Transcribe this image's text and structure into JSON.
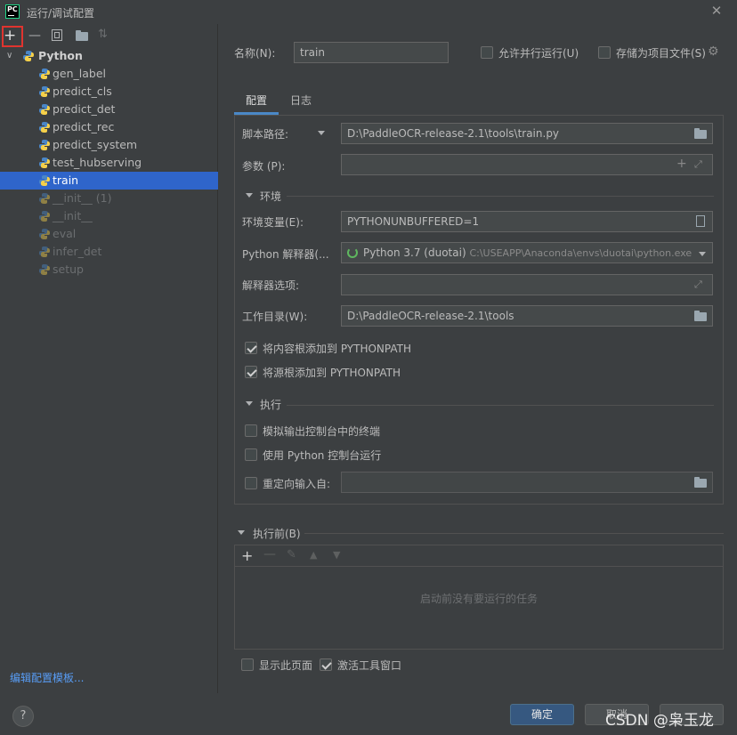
{
  "window": {
    "title": "运行/调试配置",
    "app_icon": "PC"
  },
  "toolbar_left": {
    "add": "+",
    "remove": "—"
  },
  "tree": {
    "root": "Python",
    "items": [
      {
        "label": "gen_label",
        "state": "normal"
      },
      {
        "label": "predict_cls",
        "state": "normal"
      },
      {
        "label": "predict_det",
        "state": "normal"
      },
      {
        "label": "predict_rec",
        "state": "normal"
      },
      {
        "label": "predict_system",
        "state": "normal"
      },
      {
        "label": "test_hubserving",
        "state": "normal"
      },
      {
        "label": "train",
        "state": "selected"
      },
      {
        "label": "__init__ (1)",
        "state": "dim"
      },
      {
        "label": "__init__",
        "state": "dim"
      },
      {
        "label": "eval",
        "state": "dim"
      },
      {
        "label": "infer_det",
        "state": "dim"
      },
      {
        "label": "setup",
        "state": "dim"
      }
    ]
  },
  "edit_template_link": "编辑配置模板...",
  "help": "?",
  "header": {
    "name_label": "名称(N):",
    "name_value": "train",
    "parallel_label": "允许并行运行(U)",
    "store_label": "存储为项目文件(S)"
  },
  "tabs": [
    {
      "label": "配置",
      "active": true
    },
    {
      "label": "日志",
      "active": false
    }
  ],
  "config": {
    "script_label": "脚本路径:",
    "script_value": "D:\\PaddleOCR-release-2.1\\tools\\train.py",
    "params_label": "参数 (P):",
    "params_value": "",
    "env_section": "环境",
    "envvars_label": "环境变量(E):",
    "envvars_value": "PYTHONUNBUFFERED=1",
    "interp_label": "Python 解释器(...",
    "interp_name": "Python 3.7 (duotai)",
    "interp_path": "C:\\USEAPP\\Anaconda\\envs\\duotai\\python.exe",
    "interp_opts_label": "解释器选项:",
    "workdir_label": "工作目录(W):",
    "workdir_value": "D:\\PaddleOCR-release-2.1\\tools",
    "add_content_roots": "将内容根添加到 PYTHONPATH",
    "add_source_roots": "将源根添加到 PYTHONPATH",
    "exec_section": "执行",
    "emulate_terminal": "模拟输出控制台中的终端",
    "python_console": "使用 Python 控制台运行",
    "redirect_input": "重定向输入自:"
  },
  "before_launch": {
    "section": "执行前(B)",
    "empty_text": "启动前没有要运行的任务"
  },
  "footer": {
    "show_page": "显示此页面",
    "activate_tool": "激活工具窗口",
    "ok": "确定",
    "cancel": "取消",
    "apply": ""
  },
  "watermark": "CSDN @枭玉龙",
  "colors": {
    "accent": "#2f65ca",
    "ok_button": "#365880",
    "highlight_border": "#e0342f",
    "link": "#589df6"
  }
}
